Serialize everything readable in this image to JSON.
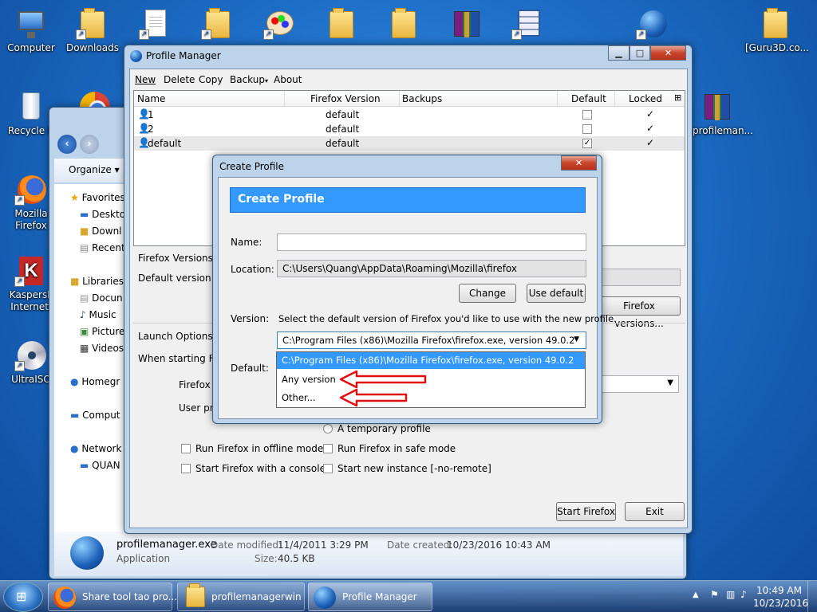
{
  "desktop": {
    "icons": [
      {
        "name": "Computer",
        "kind": "monitor"
      },
      {
        "name": "Downloads",
        "kind": "folder"
      },
      {
        "name": "Recycle Bin",
        "kind": "bin"
      },
      {
        "name": "Mozilla Firefox",
        "kind": "ff"
      },
      {
        "name": "Kaspersky Internet...",
        "kind": "kas"
      },
      {
        "name": "UltraISO",
        "kind": "disc"
      },
      {
        "name": "[Guru3D.co...",
        "kind": "folder"
      },
      {
        "name": "profileman...",
        "kind": "rar"
      }
    ],
    "recycle_label": "Recycle B",
    "firefox_l1": "Mozilla",
    "firefox_l2": "Firefox",
    "kas_l1": "Kaspersk",
    "kas_l2": "Internet.",
    "ultra": "UltraISO"
  },
  "explorer": {
    "organize": "Organize",
    "nav": [
      "Favorites",
      "Deskto",
      "Downl",
      "Recent",
      "Libraries",
      "Docun",
      "Music",
      "Picture",
      "Videos",
      "Homegr",
      "Comput",
      "Network",
      "QUAN"
    ],
    "file_name": "profilemanager.exe",
    "file_type": "Application",
    "date_modified_label": "Date modified:",
    "date_modified": "11/4/2011 3:29 PM",
    "date_created_label": "Date created:",
    "date_created": "10/23/2016 10:43 AM",
    "size_label": "Size:",
    "size": "40.5 KB"
  },
  "profile_manager": {
    "title": "Profile Manager",
    "menu": [
      "New",
      "Delete",
      "Copy",
      "Backup",
      "About"
    ],
    "columns": {
      "name": "Name",
      "version": "Firefox Version",
      "backups": "Backups",
      "default": "Default",
      "locked": "Locked"
    },
    "rows": [
      {
        "name": "1",
        "version": "default",
        "default": false,
        "locked": true
      },
      {
        "name": "2",
        "version": "default",
        "default": false,
        "locked": true
      },
      {
        "name": "default",
        "version": "default",
        "default": true,
        "locked": true
      }
    ],
    "firefox_versions_label": "Firefox Versions",
    "default_version_label": "Default version:",
    "firefox_versions_button": "Firefox versions...",
    "launch_options_label": "Launch Options",
    "when_starting": "When starting Firef",
    "firefox_v": "Firefox v",
    "user_pro": "User pro",
    "temporary_profile": "A temporary profile",
    "offline": "Run Firefox in offline mode",
    "safe": "Run Firefox in safe mode",
    "console": "Start Firefox with a console",
    "no_remote": "Start new instance [-no-remote]",
    "start_button": "Start Firefox",
    "exit_button": "Exit"
  },
  "create_profile": {
    "title": "Create Profile",
    "header": "Create Profile",
    "name_label": "Name:",
    "name_value": "",
    "location_label": "Location:",
    "location_value": "C:\\Users\\Quang\\AppData\\Roaming\\Mozilla\\firefox",
    "change_button": "Change",
    "use_default_button": "Use default",
    "version_label": "Version:",
    "version_help": "Select the default version of Firefox you'd like to use with the new profile.",
    "selected_version": "C:\\Program Files (x86)\\Mozilla Firefox\\firefox.exe, version 49.0.2",
    "default_label": "Default:",
    "options": [
      "C:\\Program Files (x86)\\Mozilla Firefox\\firefox.exe, version 49.0.2",
      "Any version",
      "Other..."
    ],
    "accent": "#3399ff"
  },
  "taskbar": {
    "items": [
      "Share tool tao pro...",
      "profilemanagerwin",
      "Profile Manager"
    ],
    "time": "10:49 AM",
    "date": "10/23/2016"
  }
}
